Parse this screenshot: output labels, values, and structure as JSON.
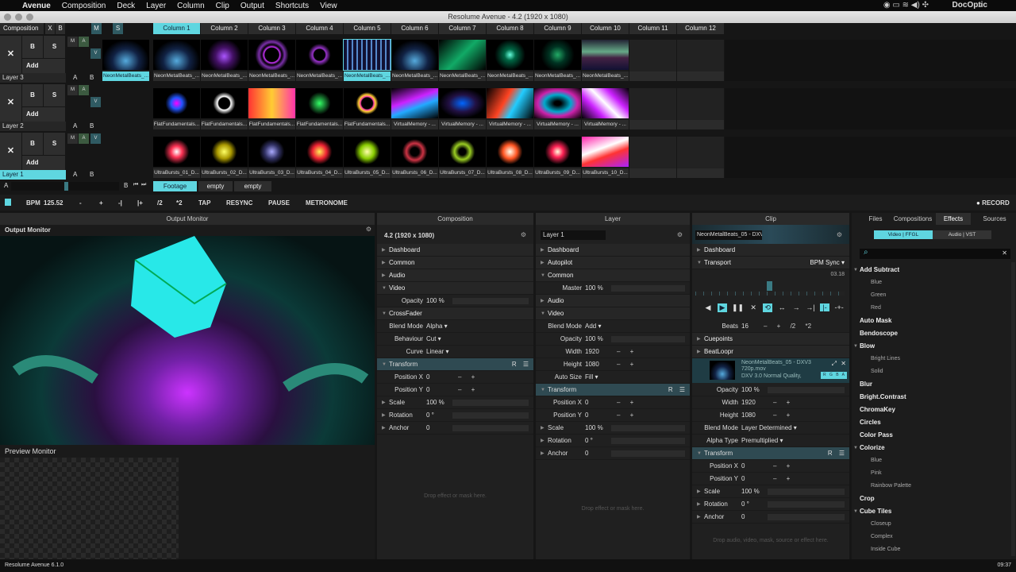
{
  "menubar": {
    "items": [
      "Avenue",
      "Composition",
      "Deck",
      "Layer",
      "Column",
      "Clip",
      "Output",
      "Shortcuts",
      "View"
    ],
    "user": "DocOptic"
  },
  "window": {
    "title": "Resolume Avenue - 4.2 (1920 x 1080)"
  },
  "composition_header": {
    "label": "Composition",
    "x": "X",
    "b": "B",
    "m": "M",
    "s": "S"
  },
  "columns": [
    "Column 1",
    "Column 2",
    "Column 3",
    "Column 4",
    "Column 5",
    "Column 6",
    "Column 7",
    "Column 8",
    "Column 9",
    "Column 10",
    "Column 11",
    "Column 12"
  ],
  "layers": [
    {
      "name": "Layer 3",
      "selected": false,
      "active_clip": "NeonMetalBeats_...",
      "clips": [
        "NeonMetalBeats_...",
        "NeonMetalBeats_...",
        "NeonMetalBeats_...",
        "NeonMetalBeats_...",
        "NeonMetalBeats_...",
        "NeonMetalBeats_...",
        "NeonMetalBeats_...",
        "NeonMetalBeats_...",
        "NeonMetalBeats_...",
        "NeonMetalBeats_..."
      ],
      "selected_col": 4
    },
    {
      "name": "Layer 2",
      "selected": false,
      "active_clip": "",
      "clips": [
        "FlatFundamentals...",
        "FlatFundamentals...",
        "FlatFundamentals...",
        "FlatFundamentals...",
        "FlatFundamentals...",
        "VirtualMemory - ...",
        "VirtualMemory - ...",
        "VirtualMemory - ...",
        "VirtualMemory - ...",
        "VirtualMemory - ..."
      ],
      "selected_col": -1
    },
    {
      "name": "Layer 1",
      "selected": true,
      "active_clip": "",
      "clips": [
        "UltraBursts_01_D...",
        "UltraBursts_02_D...",
        "UltraBursts_03_D...",
        "UltraBursts_04_D...",
        "UltraBursts_05_D...",
        "UltraBursts_06_D...",
        "UltraBursts_07_D...",
        "UltraBursts_08_D...",
        "UltraBursts_09_D...",
        "UltraBursts_10_D..."
      ],
      "selected_col": -1
    }
  ],
  "layer_controls": {
    "x": "✕",
    "b": "B",
    "s": "S",
    "add": "Add",
    "m": "M",
    "a": "A",
    "v": "V",
    "a2": "A",
    "b2": "B"
  },
  "crossfader": {
    "a": "A",
    "b": "B",
    "position": 0.42
  },
  "decks": [
    "Footage",
    "empty",
    "empty"
  ],
  "transport": {
    "bpm_label": "BPM",
    "bpm": "125.52",
    "buttons": [
      "-",
      "+",
      "-|",
      "|+",
      "/2",
      "*2",
      "TAP",
      "RESYNC",
      "PAUSE",
      "METRONOME"
    ],
    "record": "RECORD"
  },
  "panels": {
    "output": "Output Monitor",
    "composition": "Composition",
    "layer": "Layer",
    "clip": "Clip"
  },
  "output_monitor": {
    "label": "Output Monitor",
    "preview_label": "Preview Monitor"
  },
  "composition_panel": {
    "name": "4.2 (1920 x 1080)",
    "rows": [
      {
        "t": "sec",
        "l": "Dashboard"
      },
      {
        "t": "sec",
        "l": "Common"
      },
      {
        "t": "sec",
        "l": "Audio"
      },
      {
        "t": "sec",
        "l": "Video",
        "open": true
      },
      {
        "t": "p",
        "l": "Opacity",
        "v": "100 %",
        "bar": 1
      },
      {
        "t": "sec",
        "l": "CrossFader",
        "open": true
      },
      {
        "t": "p",
        "l": "Blend Mode",
        "v": "Alpha ▾"
      },
      {
        "t": "p",
        "l": "Behaviour",
        "v": "Cut ▾"
      },
      {
        "t": "p",
        "l": "Curve",
        "v": "Linear ▾"
      },
      {
        "t": "hl",
        "l": "Transform",
        "open": true,
        "r": "R ☰"
      },
      {
        "t": "p",
        "l": "Position X",
        "v": "0",
        "c": "– +"
      },
      {
        "t": "p",
        "l": "Position Y",
        "v": "0",
        "c": "– +"
      },
      {
        "t": "ps",
        "l": "Scale",
        "v": "100 %",
        "bar": 1
      },
      {
        "t": "ps",
        "l": "Rotation",
        "v": "0 °",
        "bar": 1
      },
      {
        "t": "ps",
        "l": "Anchor",
        "v": "0",
        "bar": 1
      }
    ],
    "drop": "Drop effect or mask here."
  },
  "layer_panel": {
    "name": "Layer 1",
    "rows": [
      {
        "t": "sec",
        "l": "Dashboard"
      },
      {
        "t": "sec",
        "l": "Autopilot"
      },
      {
        "t": "sec",
        "l": "Common",
        "open": true
      },
      {
        "t": "p",
        "l": "Master",
        "v": "100 %",
        "bar": 1
      },
      {
        "t": "sec",
        "l": "Audio"
      },
      {
        "t": "sec",
        "l": "Video",
        "open": true
      },
      {
        "t": "p",
        "l": "Blend Mode",
        "v": "Add ▾"
      },
      {
        "t": "p",
        "l": "Opacity",
        "v": "100 %",
        "bar": 1
      },
      {
        "t": "p",
        "l": "Width",
        "v": "1920",
        "c": "– +"
      },
      {
        "t": "p",
        "l": "Height",
        "v": "1080",
        "c": "– +"
      },
      {
        "t": "p",
        "l": "Auto Size",
        "v": "Fill ▾"
      },
      {
        "t": "hl",
        "l": "Transform",
        "open": true,
        "r": "R ☰"
      },
      {
        "t": "p",
        "l": "Position X",
        "v": "0",
        "c": "– +"
      },
      {
        "t": "p",
        "l": "Position Y",
        "v": "0",
        "c": "– +"
      },
      {
        "t": "ps",
        "l": "Scale",
        "v": "100 %",
        "bar": 1
      },
      {
        "t": "ps",
        "l": "Rotation",
        "v": "0 °",
        "bar": 1
      },
      {
        "t": "ps",
        "l": "Anchor",
        "v": "0",
        "bar": 1
      }
    ],
    "drop": "Drop effect or mask here."
  },
  "clip_panel": {
    "name": "NeonMetalBeats_05 - DXV...",
    "dashboard": "Dashboard",
    "transport": "Transport",
    "sync": "BPM Sync ▾",
    "time": "03.18",
    "progress": 0.5,
    "beats_label": "Beats",
    "beats": "16",
    "beat_ctl": "– + /2 *2",
    "cuepoints": "Cuepoints",
    "beatloopr": "BeatLoopr",
    "file": "NeonMetalBeats_05 - DXV3 720p.mov",
    "codec": "DXV 3.0 Normal Quality,",
    "rgba": "R G B A",
    "rows": [
      {
        "t": "p",
        "l": "Opacity",
        "v": "100 %",
        "bar": 1
      },
      {
        "t": "p",
        "l": "Width",
        "v": "1920",
        "c": "– +"
      },
      {
        "t": "p",
        "l": "Height",
        "v": "1080",
        "c": "– +"
      },
      {
        "t": "p",
        "l": "Blend Mode",
        "v": "Layer Determined ▾"
      },
      {
        "t": "p",
        "l": "Alpha Type",
        "v": "Premultiplied ▾"
      },
      {
        "t": "hl",
        "l": "Transform",
        "open": true,
        "r": "R ☰"
      },
      {
        "t": "p",
        "l": "Position X",
        "v": "0",
        "c": "– +"
      },
      {
        "t": "p",
        "l": "Position Y",
        "v": "0",
        "c": "– +"
      },
      {
        "t": "ps",
        "l": "Scale",
        "v": "100 %",
        "bar": 1
      },
      {
        "t": "ps",
        "l": "Rotation",
        "v": "0 °",
        "bar": 1
      },
      {
        "t": "ps",
        "l": "Anchor",
        "v": "0",
        "bar": 1
      }
    ],
    "drop": "Drop audio, video, mask, source or effect here."
  },
  "browser": {
    "tabs": [
      "Files",
      "Compositions",
      "Effects",
      "Sources"
    ],
    "active_tab": 2,
    "sub_tabs": [
      "Video | FFGL",
      "Audio | VST"
    ],
    "items": [
      {
        "l": "Add Subtract",
        "g": 1,
        "open": 1
      },
      {
        "l": "Blue"
      },
      {
        "l": "Green"
      },
      {
        "l": "Red"
      },
      {
        "l": "Auto Mask",
        "g": 1
      },
      {
        "l": "Bendoscope",
        "g": 1
      },
      {
        "l": "Blow",
        "g": 1,
        "open": 1
      },
      {
        "l": "Bright Lines"
      },
      {
        "l": "Solid"
      },
      {
        "l": "Blur",
        "g": 1
      },
      {
        "l": "Bright.Contrast",
        "g": 1
      },
      {
        "l": "ChromaKey",
        "g": 1
      },
      {
        "l": "Circles",
        "g": 1
      },
      {
        "l": "Color Pass",
        "g": 1
      },
      {
        "l": "Colorize",
        "g": 1,
        "open": 1
      },
      {
        "l": "Blue"
      },
      {
        "l": "Pink"
      },
      {
        "l": "Rainbow Palette"
      },
      {
        "l": "Crop",
        "g": 1
      },
      {
        "l": "Cube Tiles",
        "g": 1,
        "open": 1
      },
      {
        "l": "Closeup"
      },
      {
        "l": "Complex"
      },
      {
        "l": "Inside Cube"
      }
    ]
  },
  "status": {
    "left": "Resolume Avenue 6.1.0",
    "right": "09:37"
  },
  "colors": {
    "accent": "#5fd6e0"
  }
}
